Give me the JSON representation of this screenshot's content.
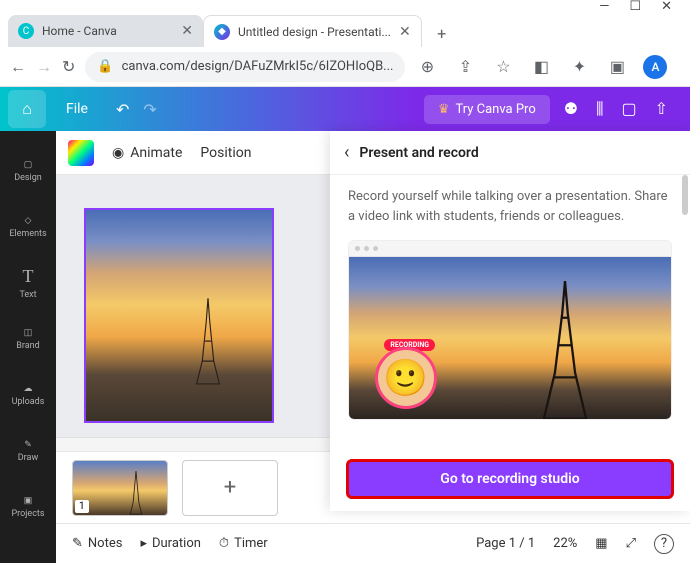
{
  "window": {
    "min": "—",
    "max": "☐",
    "close": "✕"
  },
  "tabs": [
    {
      "title": "Home - Canva",
      "favicon": "C",
      "close": "✕"
    },
    {
      "title": "Untitled design - Presentati...",
      "favicon": "◆",
      "close": "✕"
    }
  ],
  "newtab": "+",
  "addressbar": {
    "back": "←",
    "forward": "→",
    "reload": "↻",
    "lock": "🔒",
    "url": "canva.com/design/DAFuZMrkI5c/6IZOHIoQB...",
    "zoom": "⊕",
    "share": "⇪",
    "star": "☆",
    "ext": "◧",
    "puzzle": "✦",
    "split": "▣",
    "profile": "A",
    "menu": "⋮"
  },
  "header": {
    "home": "⌂",
    "file": "File",
    "undo": "↶",
    "redo": "↷",
    "try_pro": "Try Canva Pro",
    "crown": "♛",
    "icons": {
      "people": "⚉",
      "chart": "⫼",
      "present": "▢",
      "share": "⇧"
    }
  },
  "sidebar": [
    {
      "icon": "▢",
      "label": "Design"
    },
    {
      "icon": "◇",
      "label": "Elements"
    },
    {
      "icon": "T",
      "label": "Text"
    },
    {
      "icon": "◫",
      "label": "Brand"
    },
    {
      "icon": "☁",
      "label": "Uploads"
    },
    {
      "icon": "✎",
      "label": "Draw"
    },
    {
      "icon": "▣",
      "label": "Projects"
    }
  ],
  "toolbar": {
    "animate": "Animate",
    "position": "Position",
    "anim_icon": "◉"
  },
  "thumbs": {
    "num": "1",
    "add": "+"
  },
  "footer": {
    "notes": "Notes",
    "duration": "Duration",
    "timer": "Timer",
    "page": "Page 1 / 1",
    "zoom": "22%",
    "grid": "▦",
    "expand": "⤢",
    "help": "?"
  },
  "panel": {
    "back": "‹",
    "title": "Present and record",
    "desc": "Record yourself while talking over a presentation. Share a video link with students, friends or colleagues.",
    "rec_badge": "RECORDING",
    "button": "Go to recording studio"
  }
}
